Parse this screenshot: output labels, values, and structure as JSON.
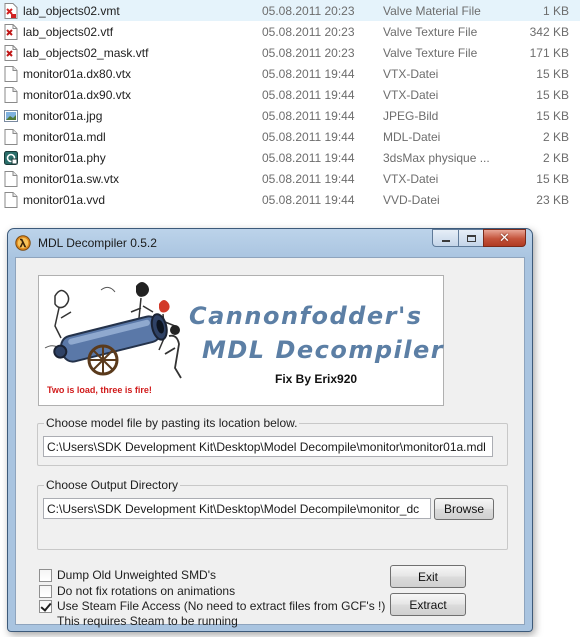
{
  "files": [
    {
      "name": "lab_objects02.vmt",
      "date": "05.08.2011 20:23",
      "type": "Valve Material File",
      "size": "1 KB",
      "icon": "vmt-file-icon"
    },
    {
      "name": "lab_objects02.vtf",
      "date": "05.08.2011 20:23",
      "type": "Valve Texture File",
      "size": "342 KB",
      "icon": "vtf-file-icon"
    },
    {
      "name": "lab_objects02_mask.vtf",
      "date": "05.08.2011 20:23",
      "type": "Valve Texture File",
      "size": "171 KB",
      "icon": "vtf-file-icon"
    },
    {
      "name": "monitor01a.dx80.vtx",
      "date": "05.08.2011 19:44",
      "type": "VTX-Datei",
      "size": "15 KB",
      "icon": "generic-file-icon"
    },
    {
      "name": "monitor01a.dx90.vtx",
      "date": "05.08.2011 19:44",
      "type": "VTX-Datei",
      "size": "15 KB",
      "icon": "generic-file-icon"
    },
    {
      "name": "monitor01a.jpg",
      "date": "05.08.2011 19:44",
      "type": "JPEG-Bild",
      "size": "15 KB",
      "icon": "image-file-icon"
    },
    {
      "name": "monitor01a.mdl",
      "date": "05.08.2011 19:44",
      "type": "MDL-Datei",
      "size": "2 KB",
      "icon": "generic-file-icon"
    },
    {
      "name": "monitor01a.phy",
      "date": "05.08.2011 19:44",
      "type": "3dsMax physique ...",
      "size": "2 KB",
      "icon": "phy-file-icon"
    },
    {
      "name": "monitor01a.sw.vtx",
      "date": "05.08.2011 19:44",
      "type": "VTX-Datei",
      "size": "15 KB",
      "icon": "generic-file-icon"
    },
    {
      "name": "monitor01a.vvd",
      "date": "05.08.2011 19:44",
      "type": "VVD-Datei",
      "size": "23 KB",
      "icon": "generic-file-icon"
    }
  ],
  "window": {
    "title": "MDL Decompiler 0.5.2",
    "min_glyph": "",
    "close_glyph": "✕"
  },
  "banner": {
    "line1": "Cannonfodder's",
    "line2": "MDL Decompiler",
    "fix": "Fix By Erix920",
    "motto": "Two is load, three is fire!"
  },
  "model_group": {
    "label": "Choose model file by pasting its location below.",
    "value": "C:\\Users\\SDK Development Kit\\Desktop\\Model Decompile\\monitor\\monitor01a.mdl"
  },
  "output_group": {
    "label": "Choose Output Directory",
    "value": "C:\\Users\\SDK Development Kit\\Desktop\\Model Decompile\\monitor_dc",
    "browse_label": "Browse"
  },
  "options": [
    {
      "label": "Dump Old Unweighted SMD's",
      "checked": false
    },
    {
      "label": "Do not fix rotations on animations",
      "checked": false
    },
    {
      "label": "Use Steam File Access (No need to extract files from GCF's !)",
      "checked": true
    }
  ],
  "steam_note": "This requires Steam to be running",
  "buttons": {
    "exit_label": "Exit",
    "extract_label": "Extract"
  },
  "colors": {
    "banner_title": "#5c7fa5",
    "motto": "#d11b1b",
    "window_frame": "#a9c4e0"
  }
}
